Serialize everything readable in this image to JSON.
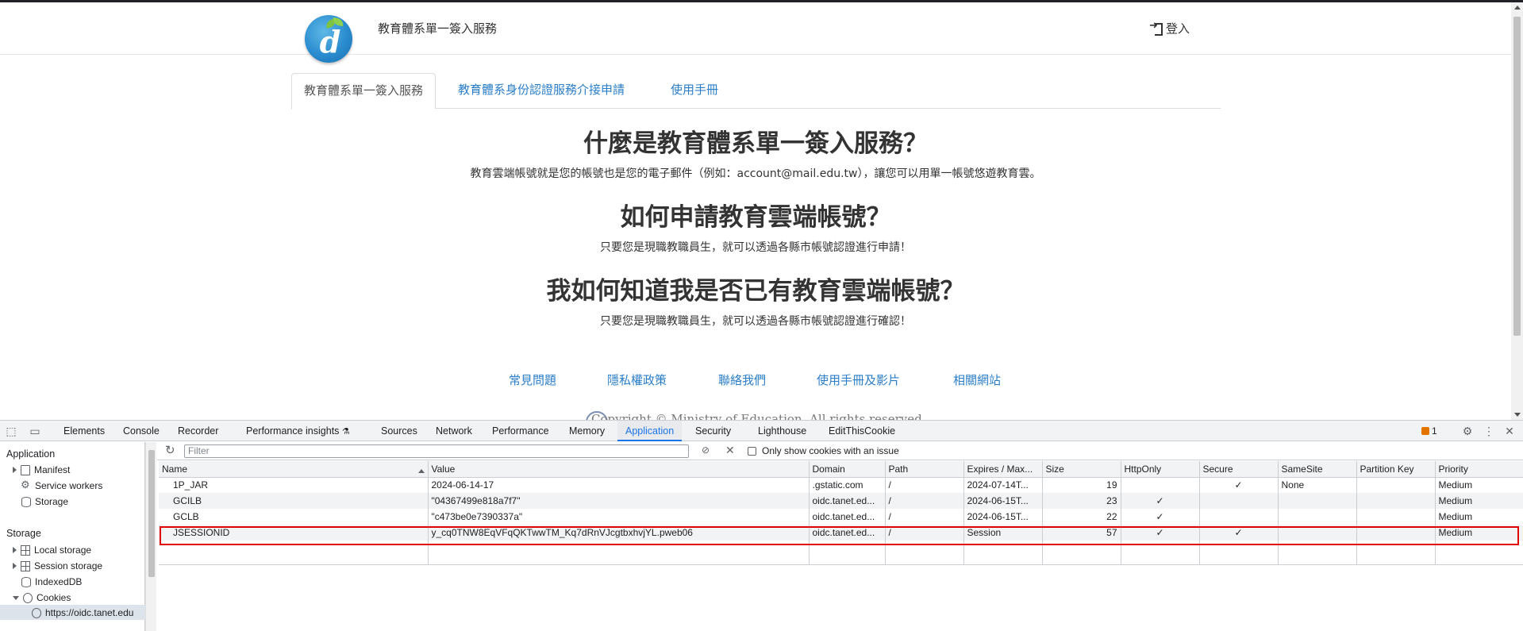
{
  "site": {
    "title": "教育體系單一簽入服務",
    "login_label": "登入"
  },
  "tabs": [
    {
      "label": "教育體系單一簽入服務",
      "active": true
    },
    {
      "label": "教育體系身份認證服務介接申請",
      "active": false
    },
    {
      "label": "使用手冊",
      "active": false
    }
  ],
  "content": {
    "q1": "什麼是教育體系單一簽入服務？",
    "a1": "教育雲端帳號就是您的帳號也是您的電子郵件（例如：account@mail.edu.tw），讓您可以用單一帳號悠遊教育雲。",
    "q2": "如何申請教育雲端帳號？",
    "a2": "只要您是現職教職員生，就可以透過各縣市帳號認證進行申請！",
    "q3": "我如何知道我是否已有教育雲端帳號？",
    "a3": "只要您是現職教職員生，就可以透過各縣市帳號認證進行確認！"
  },
  "footer": {
    "links": [
      "常見問題",
      "隱私權政策",
      "聯絡我們",
      "使用手冊及影片",
      "相關網站"
    ],
    "copyright": "Copyright © Ministry of Education. All rights reserved."
  },
  "devtools": {
    "tabs": [
      "Elements",
      "Console",
      "Recorder",
      "Performance insights",
      "Sources",
      "Network",
      "Performance",
      "Memory",
      "Application",
      "Security",
      "Lighthouse",
      "EditThisCookie"
    ],
    "active_tab": "Application",
    "issues_count": "1",
    "sidebar": {
      "application_header": "Application",
      "application_items": [
        "Manifest",
        "Service workers",
        "Storage"
      ],
      "storage_header": "Storage",
      "storage_items": [
        "Local storage",
        "Session storage",
        "IndexedDB",
        "Cookies"
      ],
      "cookie_origin": "https://oidc.tanet.edu"
    },
    "filter": {
      "placeholder": "Filter",
      "only_issues_label": "Only show cookies with an issue"
    },
    "columns": [
      "Name",
      "Value",
      "Domain",
      "Path",
      "Expires / Max...",
      "Size",
      "HttpOnly",
      "Secure",
      "SameSite",
      "Partition Key",
      "Priority"
    ],
    "rows": [
      {
        "name": "1P_JAR",
        "value": "2024-06-14-17",
        "domain": ".gstatic.com",
        "path": "/",
        "expires": "2024-07-14T...",
        "size": "19",
        "httponly": "",
        "secure": "✓",
        "samesite": "None",
        "partition": "",
        "priority": "Medium"
      },
      {
        "name": "GCILB",
        "value": "\"04367499e818a7f7\"",
        "domain": "oidc.tanet.ed...",
        "path": "/",
        "expires": "2024-06-15T...",
        "size": "23",
        "httponly": "✓",
        "secure": "",
        "samesite": "",
        "partition": "",
        "priority": "Medium"
      },
      {
        "name": "GCLB",
        "value": "\"c473be0e7390337a\"",
        "domain": "oidc.tanet.ed...",
        "path": "/",
        "expires": "2024-06-15T...",
        "size": "22",
        "httponly": "✓",
        "secure": "",
        "samesite": "",
        "partition": "",
        "priority": "Medium"
      },
      {
        "name": "JSESSIONID",
        "value": "y_cq0TNW8EqVFqQKTwwTM_Kq7dRnVJcgtbxhvjYL.pweb06",
        "domain": "oidc.tanet.ed...",
        "path": "/",
        "expires": "Session",
        "size": "57",
        "httponly": "✓",
        "secure": "✓",
        "samesite": "",
        "partition": "",
        "priority": "Medium"
      }
    ],
    "colors": {
      "highlight": "#e00000",
      "accent": "#1a73e8",
      "issue": "#e37400"
    }
  }
}
